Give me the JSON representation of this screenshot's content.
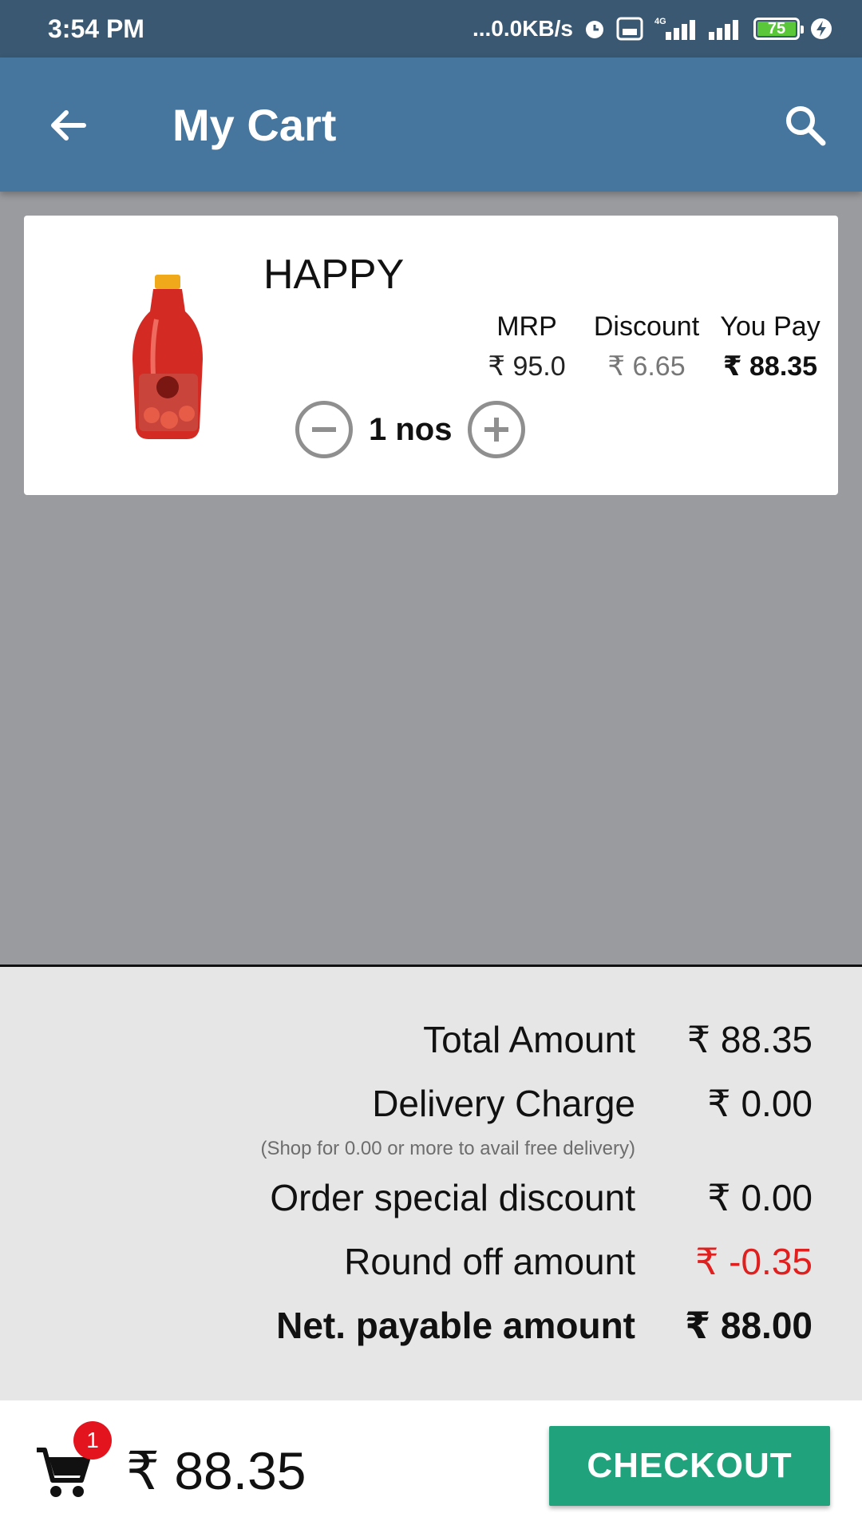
{
  "status_bar": {
    "time": "3:54 PM",
    "network_speed": "...0.0KB/s",
    "network_type": "4G",
    "volte_label": "Vo LTE",
    "battery_level": "75",
    "icons": [
      "alarm-icon",
      "volte-icon",
      "signal-icon",
      "signal-icon",
      "battery-icon",
      "charging-icon"
    ]
  },
  "app_bar": {
    "title": "My Cart",
    "back_icon": "arrow-back-icon",
    "search_icon": "search-icon"
  },
  "cart_items": [
    {
      "name": "HAPPY",
      "headers": {
        "mrp": "MRP",
        "discount": "Discount",
        "you_pay": "You Pay"
      },
      "mrp": "₹ 95.0",
      "discount": "₹ 6.65",
      "you_pay": "₹ 88.35",
      "quantity": "1 nos"
    }
  ],
  "summary": {
    "total_label": "Total Amount",
    "total_value": "₹ 88.35",
    "delivery_label": "Delivery Charge",
    "delivery_value": "₹ 0.00",
    "delivery_note": "(Shop for 0.00 or more to avail free delivery)",
    "special_discount_label": "Order special discount",
    "special_discount_value": "₹ 0.00",
    "round_off_label": "Round off amount",
    "round_off_value": "₹ -0.35",
    "net_label": "Net. payable amount",
    "net_value": "₹ 88.00"
  },
  "bottom_bar": {
    "cart_count": "1",
    "total": "₹ 88.35",
    "checkout_label": "CHECKOUT"
  },
  "colors": {
    "status_bar": "#3a5871",
    "app_bar": "#46769d",
    "checkout": "#20a37d",
    "badge": "#e3141e",
    "negative": "#e01f1f"
  }
}
